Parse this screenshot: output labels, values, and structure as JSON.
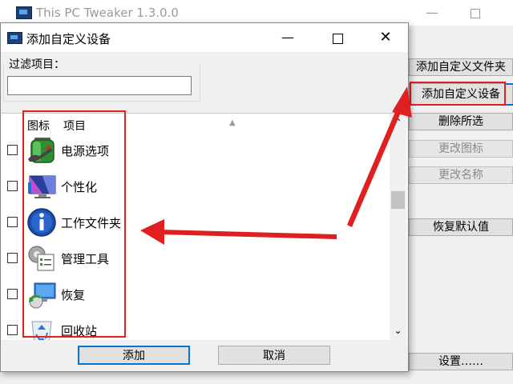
{
  "main_window": {
    "title": "This PC Tweaker 1.3.0.0",
    "minimize_glyph": "—",
    "buttons": {
      "add_folder": "添加自定义文件夹",
      "add_device": "添加自定义设备",
      "delete_selected": "删除所选",
      "change_icon": "更改图标",
      "change_name": "更改名称",
      "restore_default": "恢复默认值",
      "settings": "设置……"
    }
  },
  "dialog": {
    "title": "添加自定义设备",
    "minimize_glyph": "—",
    "close_glyph": "✕",
    "filter": {
      "label": "过滤项目：",
      "value": "",
      "placeholder": ""
    },
    "list": {
      "headers": {
        "icon": "图标",
        "item": "项目",
        "sort_glyph": "▲"
      },
      "items": [
        {
          "label": "电源选项",
          "icon": "battery-power-icon",
          "checked": false
        },
        {
          "label": "个性化",
          "icon": "personalization-monitor-icon",
          "checked": false
        },
        {
          "label": "工作文件夹",
          "icon": "info-icon",
          "checked": false
        },
        {
          "label": "管理工具",
          "icon": "admin-tools-icon",
          "checked": false
        },
        {
          "label": "恢复",
          "icon": "recovery-icon",
          "checked": false
        },
        {
          "label": "回收站",
          "icon": "recycle-bin-icon",
          "checked": false
        }
      ],
      "scroll_up_glyph": "⌃",
      "scroll_down_glyph": "⌄"
    },
    "buttons": {
      "add": "添加",
      "cancel": "取消"
    }
  },
  "colors": {
    "annotation_red": "#e02020",
    "focus_blue": "#0a6fd6"
  }
}
